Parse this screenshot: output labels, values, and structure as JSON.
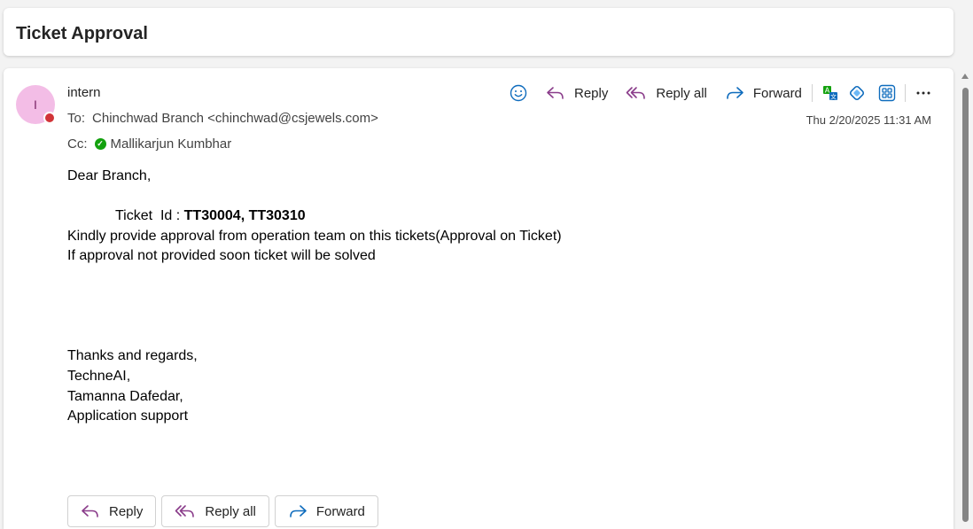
{
  "subject": "Ticket Approval",
  "sender": {
    "initial": "I",
    "name": "intern",
    "presence_color": "#d13438"
  },
  "to": {
    "label": "To:",
    "value": "Chinchwad Branch <chinchwad@csjewels.com>"
  },
  "cc": {
    "label": "Cc:",
    "value": "Mallikarjun Kumbhar"
  },
  "timestamp": "Thu 2/20/2025 11:31 AM",
  "toolbar": {
    "emoji_icon": "emoji-icon",
    "reply_label": "Reply",
    "reply_all_label": "Reply all",
    "forward_label": "Forward",
    "icons": [
      "translate-icon",
      "loop-icon",
      "apps-icon",
      "more-icon"
    ]
  },
  "body": {
    "greeting": "Dear Branch,",
    "ticket_prefix": "Ticket  Id : ",
    "ticket_ids": "TT30004, TT30310",
    "line1": "Kindly provide approval from operation team on this tickets(Approval on Ticket)",
    "line2": "If approval not provided soon ticket will be solved",
    "sig1": "Thanks and regards,",
    "sig2": "TechneAI,",
    "sig3": "Tamanna Dafedar,",
    "sig4": "Application support"
  },
  "actions": {
    "reply": "Reply",
    "reply_all": "Reply all",
    "forward": "Forward"
  },
  "colors": {
    "accent_purple": "#8a3c8a",
    "accent_blue": "#0f6cbd",
    "avatar_bg": "#f3bde6"
  }
}
